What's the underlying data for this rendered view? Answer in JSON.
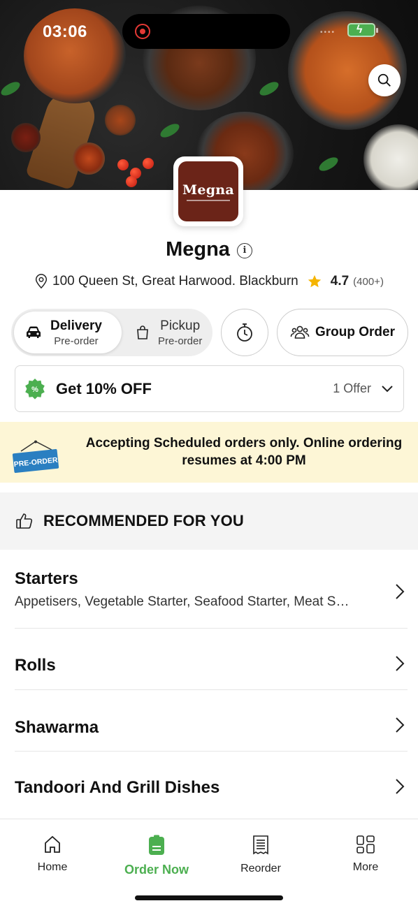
{
  "status_bar": {
    "time": "03:06"
  },
  "restaurant": {
    "logo_text": "Megna",
    "name": "Megna",
    "address": "100 Queen St, Great Harwood. Blackburn",
    "rating": "4.7",
    "reviews": "(400+)"
  },
  "modes": {
    "delivery": {
      "title": "Delivery",
      "sub": "Pre-order"
    },
    "pickup": {
      "title": "Pickup",
      "sub": "Pre-order"
    }
  },
  "group_order_label": "Group Order",
  "offer": {
    "title": "Get 10% OFF",
    "count": "1 Offer"
  },
  "banner": {
    "tag_text": "PRE-ORDER",
    "message": "Accepting Scheduled orders only. Online ordering resumes at 4:00 PM"
  },
  "recommended_label": "RECOMMENDED FOR YOU",
  "categories": [
    {
      "title": "Starters",
      "subtitle": "Appetisers, Vegetable Starter, Seafood Starter, Meat S…"
    },
    {
      "title": "Rolls"
    },
    {
      "title": "Shawarma"
    },
    {
      "title": "Tandoori And Grill Dishes"
    }
  ],
  "nav": [
    {
      "label": "Home",
      "icon": "home-icon"
    },
    {
      "label": "Order Now",
      "icon": "order-now-icon"
    },
    {
      "label": "Reorder",
      "icon": "receipt-icon"
    },
    {
      "label": "More",
      "icon": "grid-icon"
    }
  ],
  "colors": {
    "accent": "#4caf50",
    "banner_bg": "#fdf6d6",
    "logo_bg": "#6b2418",
    "star": "#f5b400"
  }
}
